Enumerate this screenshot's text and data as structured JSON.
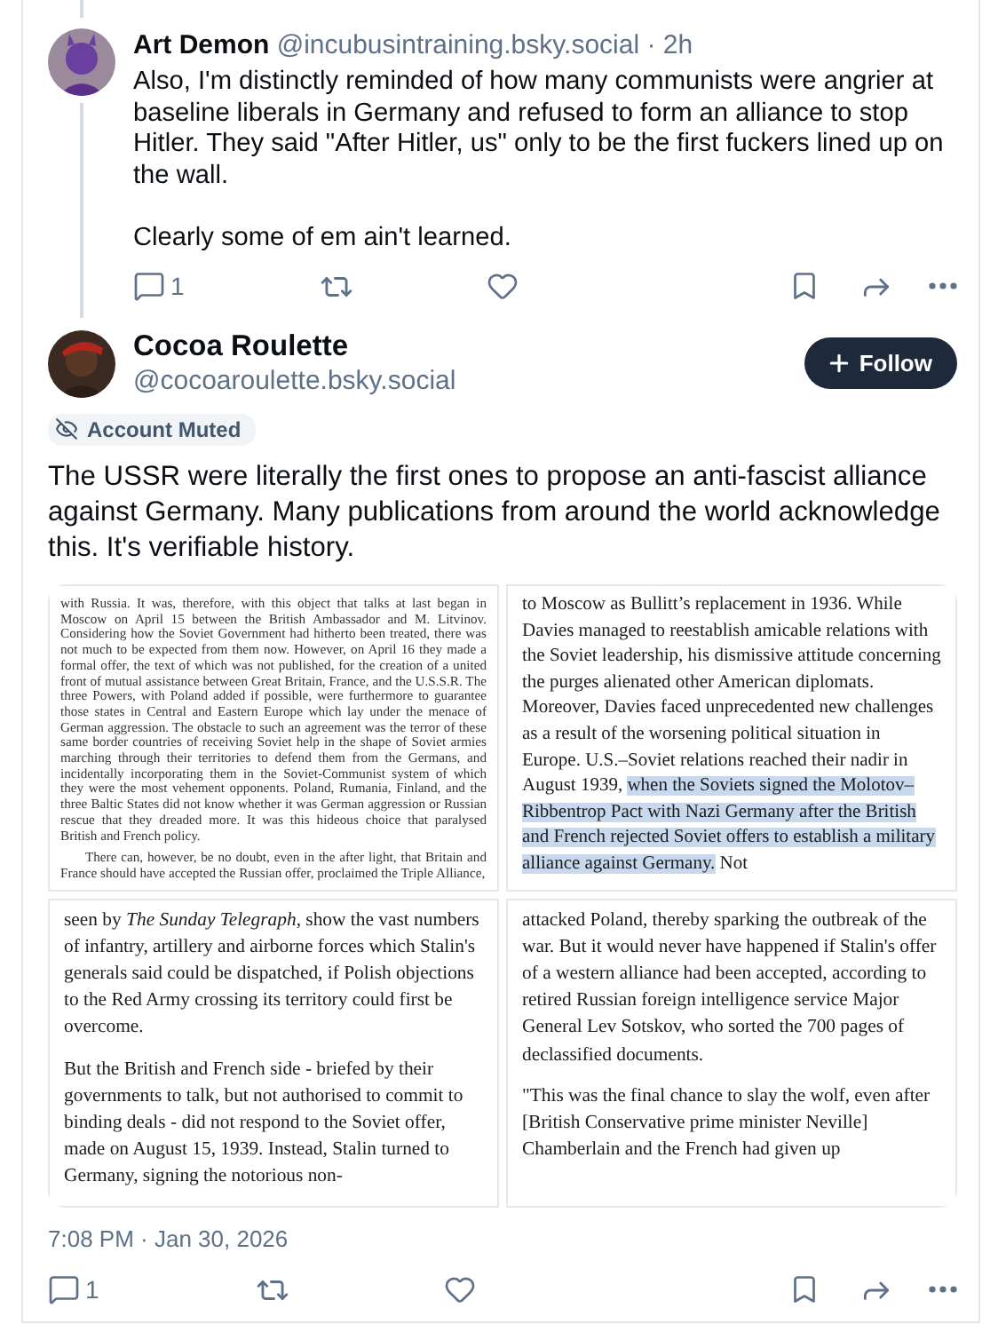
{
  "reply_post": {
    "author": "Art Demon",
    "handle": "@incubusintraining.bsky.social",
    "time": "· 2h",
    "paragraphs": [
      "Also, I'm distinctly reminded of how many communists were angrier at baseline liberals in Germany and refused to form an alliance to stop Hitler. They said \"After Hitler, us\" only to be the first fuckers lined up on the wall.",
      "Clearly some of em ain't learned."
    ],
    "reply_count": "1"
  },
  "main_post": {
    "author": "Cocoa Roulette",
    "handle": "@cocoaroulette.bsky.social",
    "follow_label": "Follow",
    "muted_label": "Account Muted",
    "text": "The USSR were literally the first ones to propose an anti-fascist alliance against Germany. Many publications from around the world acknowledge this. It's verifiable history.",
    "images": [
      {
        "kind": "book",
        "paragraphs": [
          [
            {
              "text": "with Russia. It was, therefore, with this object that talks at last began in Moscow on April 15 between the British Ambassador and M. Litvinov. Considering how the Soviet Government had hitherto been treated, there was not much to be expected from them now. However, on April 16 they made a formal offer, the text of which was not published, for the creation of a united front of mutual assistance between Great Britain, France, and the U.S.S.R. The three Powers, with Poland added if possible, were furthermore to guarantee those states in Central and Eastern Europe which lay under the menace of German aggression. The obstacle to such an agreement was the terror of these same border countries of receiving Soviet help in the shape of Soviet armies marching through their territories to defend them from the Germans, and incidentally incorporating them in the Soviet-Communist system of which they were the most vehement opponents. Poland, Rumania, Finland, and the three Baltic States did not know whether it was German aggression or Russian rescue that they dreaded more. It was this hideous choice that paralysed British and French policy.",
              "selected": false
            }
          ],
          [
            {
              "text": "There can, however, be no doubt, even in the after light, that Britain and France should have accepted the Russian offer, proclaimed the Triple Alliance,",
              "selected": false
            }
          ]
        ]
      },
      {
        "kind": "web",
        "paragraphs": [
          [
            {
              "text": "to Moscow as Bullitt’s replacement in 1936. While Davies managed to reestablish amicable relations with the Soviet leadership, his dismissive attitude concerning the purges alienated other American diplomats. Moreover, Davies faced unprecedented new challenges as a result of the worsening political situation in Europe. U.S.–Soviet relations reached their nadir in August 1939, ",
              "selected": false
            },
            {
              "text": "when the Soviets signed the Molotov–Ribbentrop Pact with Nazi Germany after the British and French rejected Soviet offers to establish a military alliance against Germany.",
              "selected": true
            },
            {
              "text": " Not",
              "selected": false
            }
          ]
        ]
      },
      {
        "kind": "news",
        "paragraphs": [
          [
            {
              "text": "seen by *The Sunday Telegraph*, show the vast numbers of infantry, artillery and airborne forces which Stalin's generals said could be dispatched, if Polish objections to the Red Army crossing its territory could first be overcome.",
              "selected": false
            }
          ],
          [
            {
              "text": "But the British and French side - briefed by their governments to talk, but not authorised to commit to binding deals - did not respond to the Soviet offer, made on August 15, 1939. Instead, Stalin turned to Germany, signing the notorious non-",
              "selected": false
            }
          ]
        ]
      },
      {
        "kind": "news",
        "paragraphs": [
          [
            {
              "text": "attacked Poland, thereby sparking the outbreak of the war. But it would never have happened if Stalin's offer of a western alliance had been accepted, according to retired Russian foreign intelligence service Major General Lev Sotskov, who sorted the 700 pages of declassified documents.",
              "selected": false
            }
          ],
          [
            {
              "text": "\"This was the final chance to slay the wolf, even after [British Conservative prime minister Neville] Chamberlain and the French had given up",
              "selected": false
            }
          ]
        ]
      }
    ],
    "timestamp": "7:08 PM · Jan 30, 2026",
    "reply_count": "1"
  }
}
